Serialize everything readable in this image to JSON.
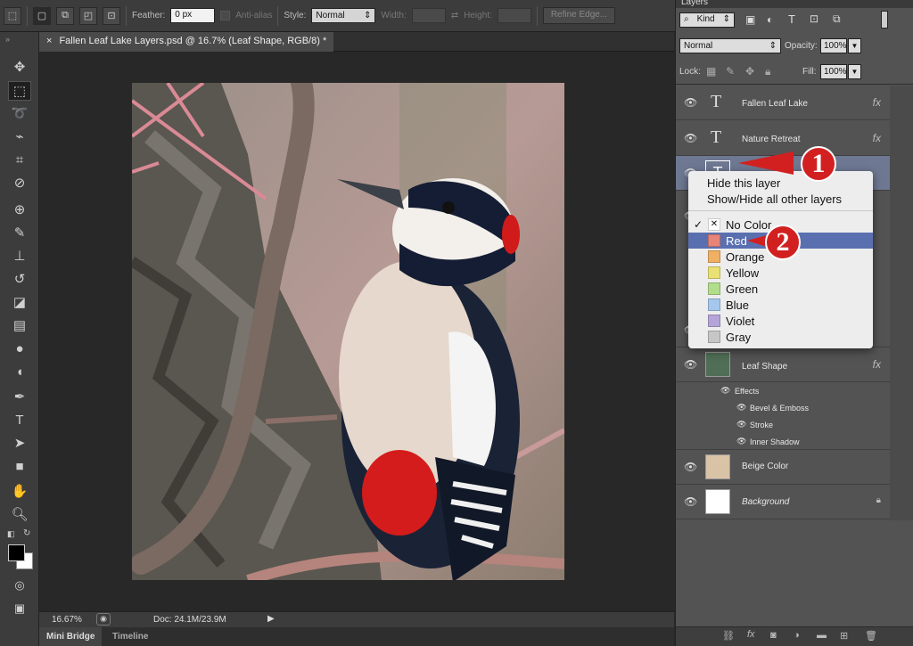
{
  "options_bar": {
    "feather_label": "Feather:",
    "feather_value": "0 px",
    "antialias_label": "Anti-alias",
    "style_label": "Style:",
    "style_value": "Normal",
    "width_label": "Width:",
    "height_label": "Height:",
    "refine_label": "Refine Edge..."
  },
  "document": {
    "tab_title": "Fallen Leaf Lake Layers.psd @ 16.7% (Leaf Shape, RGB/8) *",
    "zoom": "16.67%",
    "doc_size": "Doc: 24.1M/23.9M"
  },
  "bottom_tabs": [
    "Mini Bridge",
    "Timeline"
  ],
  "layers_panel": {
    "title": "Layers",
    "kind_label": "Kind",
    "blend_mode": "Normal",
    "opacity_label": "Opacity:",
    "opacity_value": "100%",
    "lock_label": "Lock:",
    "fill_label": "Fill:",
    "fill_value": "100%",
    "layers": [
      {
        "name": "Fallen Leaf Lake",
        "type": "text",
        "fx": "fx"
      },
      {
        "name": "Nature Retreat",
        "type": "text",
        "fx": "fx"
      },
      {
        "name": "Leaf Shape",
        "type": "shape",
        "fx": "fx"
      },
      {
        "name": "Beige Color",
        "type": "fill"
      },
      {
        "name": "Background",
        "type": "background"
      }
    ],
    "effects_label": "Effects",
    "effects": [
      "Bevel & Emboss",
      "Stroke",
      "Inner Shadow"
    ]
  },
  "context_menu": {
    "items": [
      "Hide this layer",
      "Show/Hide all other layers"
    ],
    "colors": [
      {
        "label": "No Color",
        "color": "none",
        "checked": true
      },
      {
        "label": "Red",
        "color": "#e7847a",
        "selected": true
      },
      {
        "label": "Orange",
        "color": "#efb064"
      },
      {
        "label": "Yellow",
        "color": "#e9e173"
      },
      {
        "label": "Green",
        "color": "#b2dd8b"
      },
      {
        "label": "Blue",
        "color": "#a5c7ee"
      },
      {
        "label": "Violet",
        "color": "#b5a4d8"
      },
      {
        "label": "Gray",
        "color": "#c6c6c6"
      }
    ]
  },
  "callouts": [
    "1",
    "2"
  ]
}
